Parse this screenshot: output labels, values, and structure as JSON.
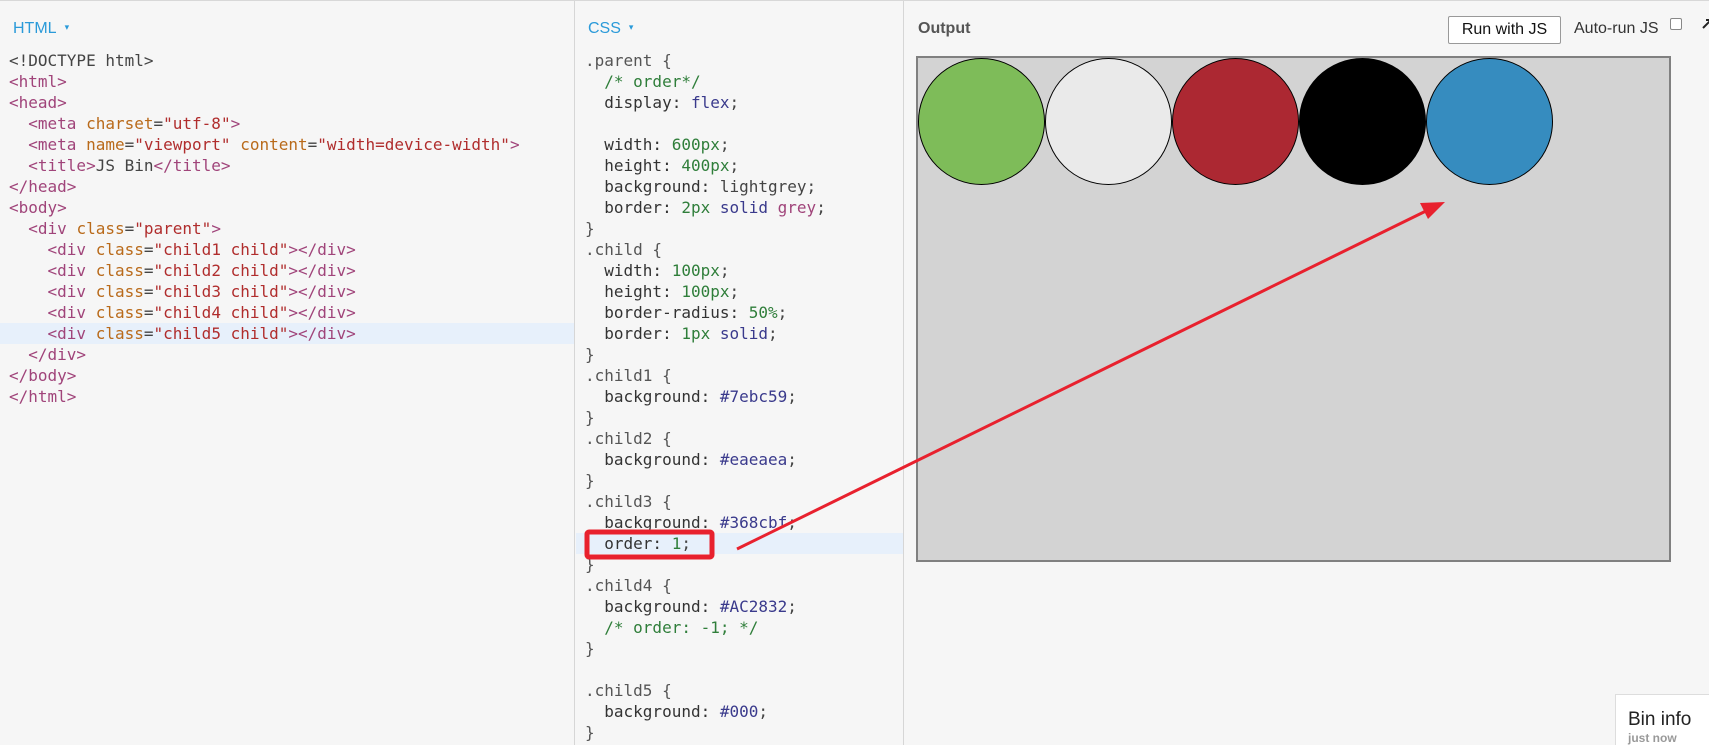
{
  "panels": {
    "html": {
      "label": "HTML",
      "caret": "▾"
    },
    "css": {
      "label": "CSS",
      "caret": "▾"
    },
    "output": {
      "label": "Output"
    }
  },
  "toolbar": {
    "run_label": "Run with JS",
    "autorun_label": "Auto-run JS",
    "autorun_checked": false
  },
  "html_code": [
    [
      [
        "t-plain",
        "<!DOCTYPE html>"
      ]
    ],
    [
      [
        "t-tag",
        "<html>"
      ]
    ],
    [
      [
        "t-tag",
        "<head>"
      ]
    ],
    [
      [
        "t-plain",
        "  "
      ],
      [
        "t-tag",
        "<meta "
      ],
      [
        "t-attr",
        "charset"
      ],
      [
        "t-plain",
        "="
      ],
      [
        "t-str",
        "\"utf-8\""
      ],
      [
        "t-tag",
        ">"
      ]
    ],
    [
      [
        "t-plain",
        "  "
      ],
      [
        "t-tag",
        "<meta "
      ],
      [
        "t-attr",
        "name"
      ],
      [
        "t-plain",
        "="
      ],
      [
        "t-str",
        "\"viewport\" "
      ],
      [
        "t-attr",
        "content"
      ],
      [
        "t-plain",
        "="
      ],
      [
        "t-str",
        "\"width=device-width\""
      ],
      [
        "t-tag",
        ">"
      ]
    ],
    [
      [
        "t-plain",
        "  "
      ],
      [
        "t-tag",
        "<title>"
      ],
      [
        "t-plain",
        "JS Bin"
      ],
      [
        "t-tag",
        "</title>"
      ]
    ],
    [
      [
        "t-tag",
        "</head>"
      ]
    ],
    [
      [
        "t-tag",
        "<body>"
      ]
    ],
    [
      [
        "t-plain",
        "  "
      ],
      [
        "t-tag",
        "<div "
      ],
      [
        "t-attr",
        "class"
      ],
      [
        "t-plain",
        "="
      ],
      [
        "t-str",
        "\"parent\""
      ],
      [
        "t-tag",
        ">"
      ]
    ],
    [
      [
        "t-plain",
        "    "
      ],
      [
        "t-tag",
        "<div "
      ],
      [
        "t-attr",
        "class"
      ],
      [
        "t-plain",
        "="
      ],
      [
        "t-str",
        "\"child1 child\""
      ],
      [
        "t-tag",
        "></div>"
      ]
    ],
    [
      [
        "t-plain",
        "    "
      ],
      [
        "t-tag",
        "<div "
      ],
      [
        "t-attr",
        "class"
      ],
      [
        "t-plain",
        "="
      ],
      [
        "t-str",
        "\"child2 child\""
      ],
      [
        "t-tag",
        "></div>"
      ]
    ],
    [
      [
        "t-plain",
        "    "
      ],
      [
        "t-tag",
        "<div "
      ],
      [
        "t-attr",
        "class"
      ],
      [
        "t-plain",
        "="
      ],
      [
        "t-str",
        "\"child3 child\""
      ],
      [
        "t-tag",
        "></div>"
      ]
    ],
    [
      [
        "t-plain",
        "    "
      ],
      [
        "t-tag",
        "<div "
      ],
      [
        "t-attr",
        "class"
      ],
      [
        "t-plain",
        "="
      ],
      [
        "t-str",
        "\"child4 child\""
      ],
      [
        "t-tag",
        "></div>"
      ]
    ],
    [
      [
        "t-plain",
        "    "
      ],
      [
        "t-tag",
        "<div "
      ],
      [
        "t-attr",
        "class"
      ],
      [
        "t-plain",
        "="
      ],
      [
        "t-str",
        "\"child5 child\""
      ],
      [
        "t-tag",
        "></div>"
      ]
    ],
    [
      [
        "t-plain",
        "  "
      ],
      [
        "t-tag",
        "</div>"
      ]
    ],
    [
      [
        "t-tag",
        "</body>"
      ]
    ],
    [
      [
        "t-tag",
        "</html>"
      ]
    ]
  ],
  "html_active_line": 13,
  "css_code": [
    [
      [
        "t-sel",
        ".parent {"
      ]
    ],
    [
      [
        "t-plain",
        "  "
      ],
      [
        "t-com",
        "/* order*/"
      ]
    ],
    [
      [
        "t-plain",
        "  "
      ],
      [
        "t-prop",
        "display: "
      ],
      [
        "t-kw",
        "flex"
      ],
      [
        "t-plain",
        ";"
      ]
    ],
    [
      [
        "t-plain",
        ""
      ]
    ],
    [
      [
        "t-plain",
        "  "
      ],
      [
        "t-prop",
        "width: "
      ],
      [
        "t-num",
        "600px"
      ],
      [
        "t-plain",
        ";"
      ]
    ],
    [
      [
        "t-plain",
        "  "
      ],
      [
        "t-prop",
        "height: "
      ],
      [
        "t-num",
        "400px"
      ],
      [
        "t-plain",
        ";"
      ]
    ],
    [
      [
        "t-plain",
        "  "
      ],
      [
        "t-prop",
        "background: "
      ],
      [
        "t-plain",
        "lightgrey;"
      ]
    ],
    [
      [
        "t-plain",
        "  "
      ],
      [
        "t-prop",
        "border: "
      ],
      [
        "t-num",
        "2px "
      ],
      [
        "t-kw",
        "solid "
      ],
      [
        "t-tag",
        "grey"
      ],
      [
        "t-plain",
        ";"
      ]
    ],
    [
      [
        "t-sel",
        "}"
      ]
    ],
    [
      [
        "t-sel",
        ".child {"
      ]
    ],
    [
      [
        "t-plain",
        "  "
      ],
      [
        "t-prop",
        "width: "
      ],
      [
        "t-num",
        "100px"
      ],
      [
        "t-plain",
        ";"
      ]
    ],
    [
      [
        "t-plain",
        "  "
      ],
      [
        "t-prop",
        "height: "
      ],
      [
        "t-num",
        "100px"
      ],
      [
        "t-plain",
        ";"
      ]
    ],
    [
      [
        "t-plain",
        "  "
      ],
      [
        "t-prop",
        "border-radius: "
      ],
      [
        "t-num",
        "50%"
      ],
      [
        "t-plain",
        ";"
      ]
    ],
    [
      [
        "t-plain",
        "  "
      ],
      [
        "t-prop",
        "border: "
      ],
      [
        "t-num",
        "1px "
      ],
      [
        "t-kw",
        "solid"
      ],
      [
        "t-plain",
        ";"
      ]
    ],
    [
      [
        "t-sel",
        "}"
      ]
    ],
    [
      [
        "t-sel",
        ".child1 {"
      ]
    ],
    [
      [
        "t-plain",
        "  "
      ],
      [
        "t-prop",
        "background: "
      ],
      [
        "t-kw",
        "#7ebc59"
      ],
      [
        "t-plain",
        ";"
      ]
    ],
    [
      [
        "t-sel",
        "}"
      ]
    ],
    [
      [
        "t-sel",
        ".child2 {"
      ]
    ],
    [
      [
        "t-plain",
        "  "
      ],
      [
        "t-prop",
        "background: "
      ],
      [
        "t-kw",
        "#eaeaea"
      ],
      [
        "t-plain",
        ";"
      ]
    ],
    [
      [
        "t-sel",
        "}"
      ]
    ],
    [
      [
        "t-sel",
        ".child3 {"
      ]
    ],
    [
      [
        "t-plain",
        "  "
      ],
      [
        "t-prop",
        "background: "
      ],
      [
        "t-kw",
        "#368cbf"
      ],
      [
        "t-plain",
        ";"
      ]
    ],
    [
      [
        "t-plain",
        "  "
      ],
      [
        "t-prop",
        "order: "
      ],
      [
        "t-num",
        "1"
      ],
      [
        "t-plain",
        ";"
      ]
    ],
    [
      [
        "t-sel",
        "}"
      ]
    ],
    [
      [
        "t-sel",
        ".child4 {"
      ]
    ],
    [
      [
        "t-plain",
        "  "
      ],
      [
        "t-prop",
        "background: "
      ],
      [
        "t-kw",
        "#AC2832"
      ],
      [
        "t-plain",
        ";"
      ]
    ],
    [
      [
        "t-plain",
        "  "
      ],
      [
        "t-com",
        "/* order: -1; */"
      ]
    ],
    [
      [
        "t-sel",
        "}"
      ]
    ],
    [
      [
        "t-plain",
        ""
      ]
    ],
    [
      [
        "t-sel",
        ".child5 {"
      ]
    ],
    [
      [
        "t-plain",
        "  "
      ],
      [
        "t-prop",
        "background: "
      ],
      [
        "t-kw",
        "#000"
      ],
      [
        "t-plain",
        ";"
      ]
    ],
    [
      [
        "t-sel",
        "}"
      ]
    ]
  ],
  "css_active_line": 23,
  "output_circles": [
    {
      "name": "child1",
      "color": "#7ebc59"
    },
    {
      "name": "child2",
      "color": "#eaeaea"
    },
    {
      "name": "child4",
      "color": "#ac2832"
    },
    {
      "name": "child5",
      "color": "#000000"
    },
    {
      "name": "child3",
      "color": "#368cbf"
    }
  ],
  "bin_info": {
    "title": "Bin info",
    "subtitle": "just now"
  },
  "annotation_color": "#e8212e"
}
